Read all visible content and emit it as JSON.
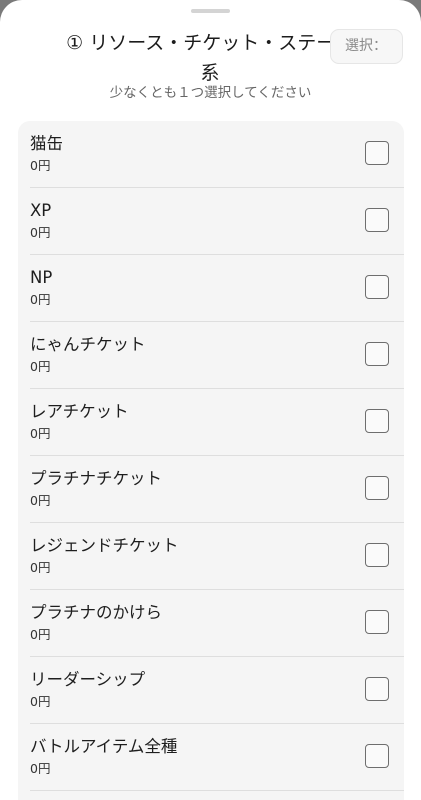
{
  "sheet": {
    "title": "① リソース・チケット・ステージ系",
    "subtitle": "少なくとも１つ選択してください",
    "select_label": "選択："
  },
  "items": [
    {
      "name": "猫缶",
      "price": "0円",
      "checked": false
    },
    {
      "name": "XP",
      "price": "0円",
      "checked": false
    },
    {
      "name": "NP",
      "price": "0円",
      "checked": false
    },
    {
      "name": "にゃんチケット",
      "price": "0円",
      "checked": false
    },
    {
      "name": "レアチケット",
      "price": "0円",
      "checked": false
    },
    {
      "name": "プラチナチケット",
      "price": "0円",
      "checked": false
    },
    {
      "name": "レジェンドチケット",
      "price": "0円",
      "checked": false
    },
    {
      "name": "プラチナのかけら",
      "price": "0円",
      "checked": false
    },
    {
      "name": "リーダーシップ",
      "price": "0円",
      "checked": false
    },
    {
      "name": "バトルアイテム全種",
      "price": "0円",
      "checked": false
    }
  ]
}
